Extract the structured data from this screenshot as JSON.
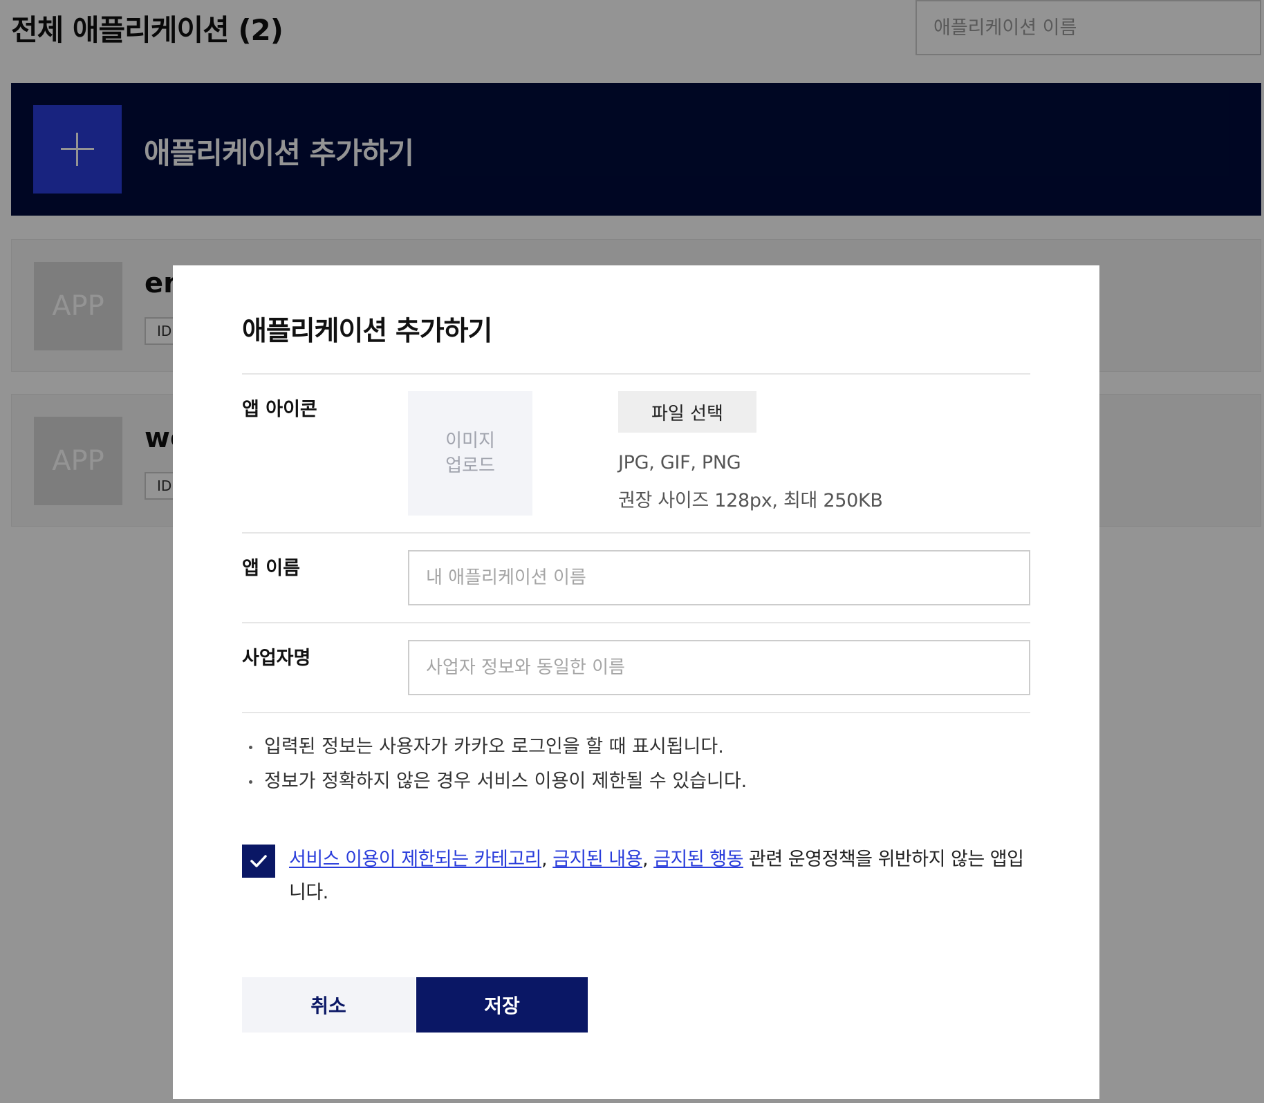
{
  "page": {
    "title": "전체 애플리케이션 (2)",
    "search_placeholder": "애플리케이션 이름",
    "add_banner_label": "애플리케이션 추가하기",
    "apps": [
      {
        "thumb_label": "APP",
        "name": "en",
        "id_label": "ID"
      },
      {
        "thumb_label": "APP",
        "name": "we",
        "id_label": "ID"
      }
    ]
  },
  "modal": {
    "title": "애플리케이션 추가하기",
    "icon_row": {
      "label": "앱 아이콘",
      "preview_line1": "이미지",
      "preview_line2": "업로드",
      "file_button": "파일 선택",
      "hint_formats": "JPG, GIF, PNG",
      "hint_size": "권장 사이즈 128px, 최대 250KB"
    },
    "name_row": {
      "label": "앱 이름",
      "placeholder": "내 애플리케이션 이름"
    },
    "company_row": {
      "label": "사업자명",
      "placeholder": "사업자 정보와 동일한 이름"
    },
    "notices": [
      "입력된 정보는 사용자가 카카오 로그인을 할 때 표시됩니다.",
      "정보가 정확하지 않은 경우 서비스 이용이 제한될 수 있습니다."
    ],
    "agreement": {
      "checked": true,
      "link1": "서비스 이용이 제한되는 카테고리",
      "sep1": ", ",
      "link2": "금지된 내용",
      "sep2": ", ",
      "link3": "금지된 행동",
      "tail": " 관련 운영정책을 위반하지 않는 앱입니다."
    },
    "cancel_label": "취소",
    "save_label": "저장"
  },
  "colors": {
    "navy": "#0a1765",
    "banner_navy": "#000c3d",
    "accent_blue": "#2a3ddb"
  },
  "icons": {
    "add": "plus-icon",
    "checkbox": "checkmark-icon"
  }
}
